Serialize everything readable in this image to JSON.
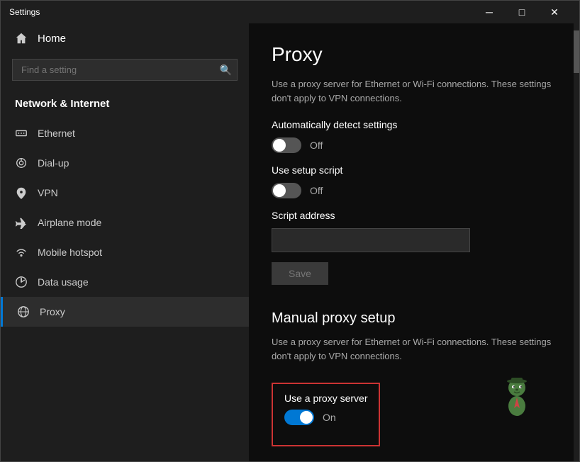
{
  "window": {
    "title": "Settings",
    "minimize_label": "─",
    "maximize_label": "□",
    "close_label": "✕"
  },
  "sidebar": {
    "home_label": "Home",
    "search_placeholder": "Find a setting",
    "nav_category": "Network & Internet",
    "nav_items": [
      {
        "id": "ethernet",
        "label": "Ethernet",
        "icon": "ethernet"
      },
      {
        "id": "dialup",
        "label": "Dial-up",
        "icon": "dialup"
      },
      {
        "id": "vpn",
        "label": "VPN",
        "icon": "vpn"
      },
      {
        "id": "airplane",
        "label": "Airplane mode",
        "icon": "airplane"
      },
      {
        "id": "hotspot",
        "label": "Mobile hotspot",
        "icon": "hotspot"
      },
      {
        "id": "datausage",
        "label": "Data usage",
        "icon": "datausage"
      },
      {
        "id": "proxy",
        "label": "Proxy",
        "icon": "proxy",
        "active": true
      }
    ]
  },
  "main": {
    "page_title": "Proxy",
    "auto_section": {
      "description": "Use a proxy server for Ethernet or Wi-Fi connections. These settings don't apply to VPN connections.",
      "auto_detect_label": "Automatically detect settings",
      "auto_detect_state": "Off",
      "setup_script_label": "Use setup script",
      "setup_script_state": "Off",
      "script_address_label": "Script address",
      "script_address_placeholder": "",
      "save_label": "Save"
    },
    "manual_section": {
      "title": "Manual proxy setup",
      "description": "Use a proxy server for Ethernet or Wi-Fi connections. These settings don't apply to VPN connections.",
      "use_proxy_label": "Use a proxy server",
      "use_proxy_state": "On",
      "use_proxy_toggle": "on"
    }
  }
}
